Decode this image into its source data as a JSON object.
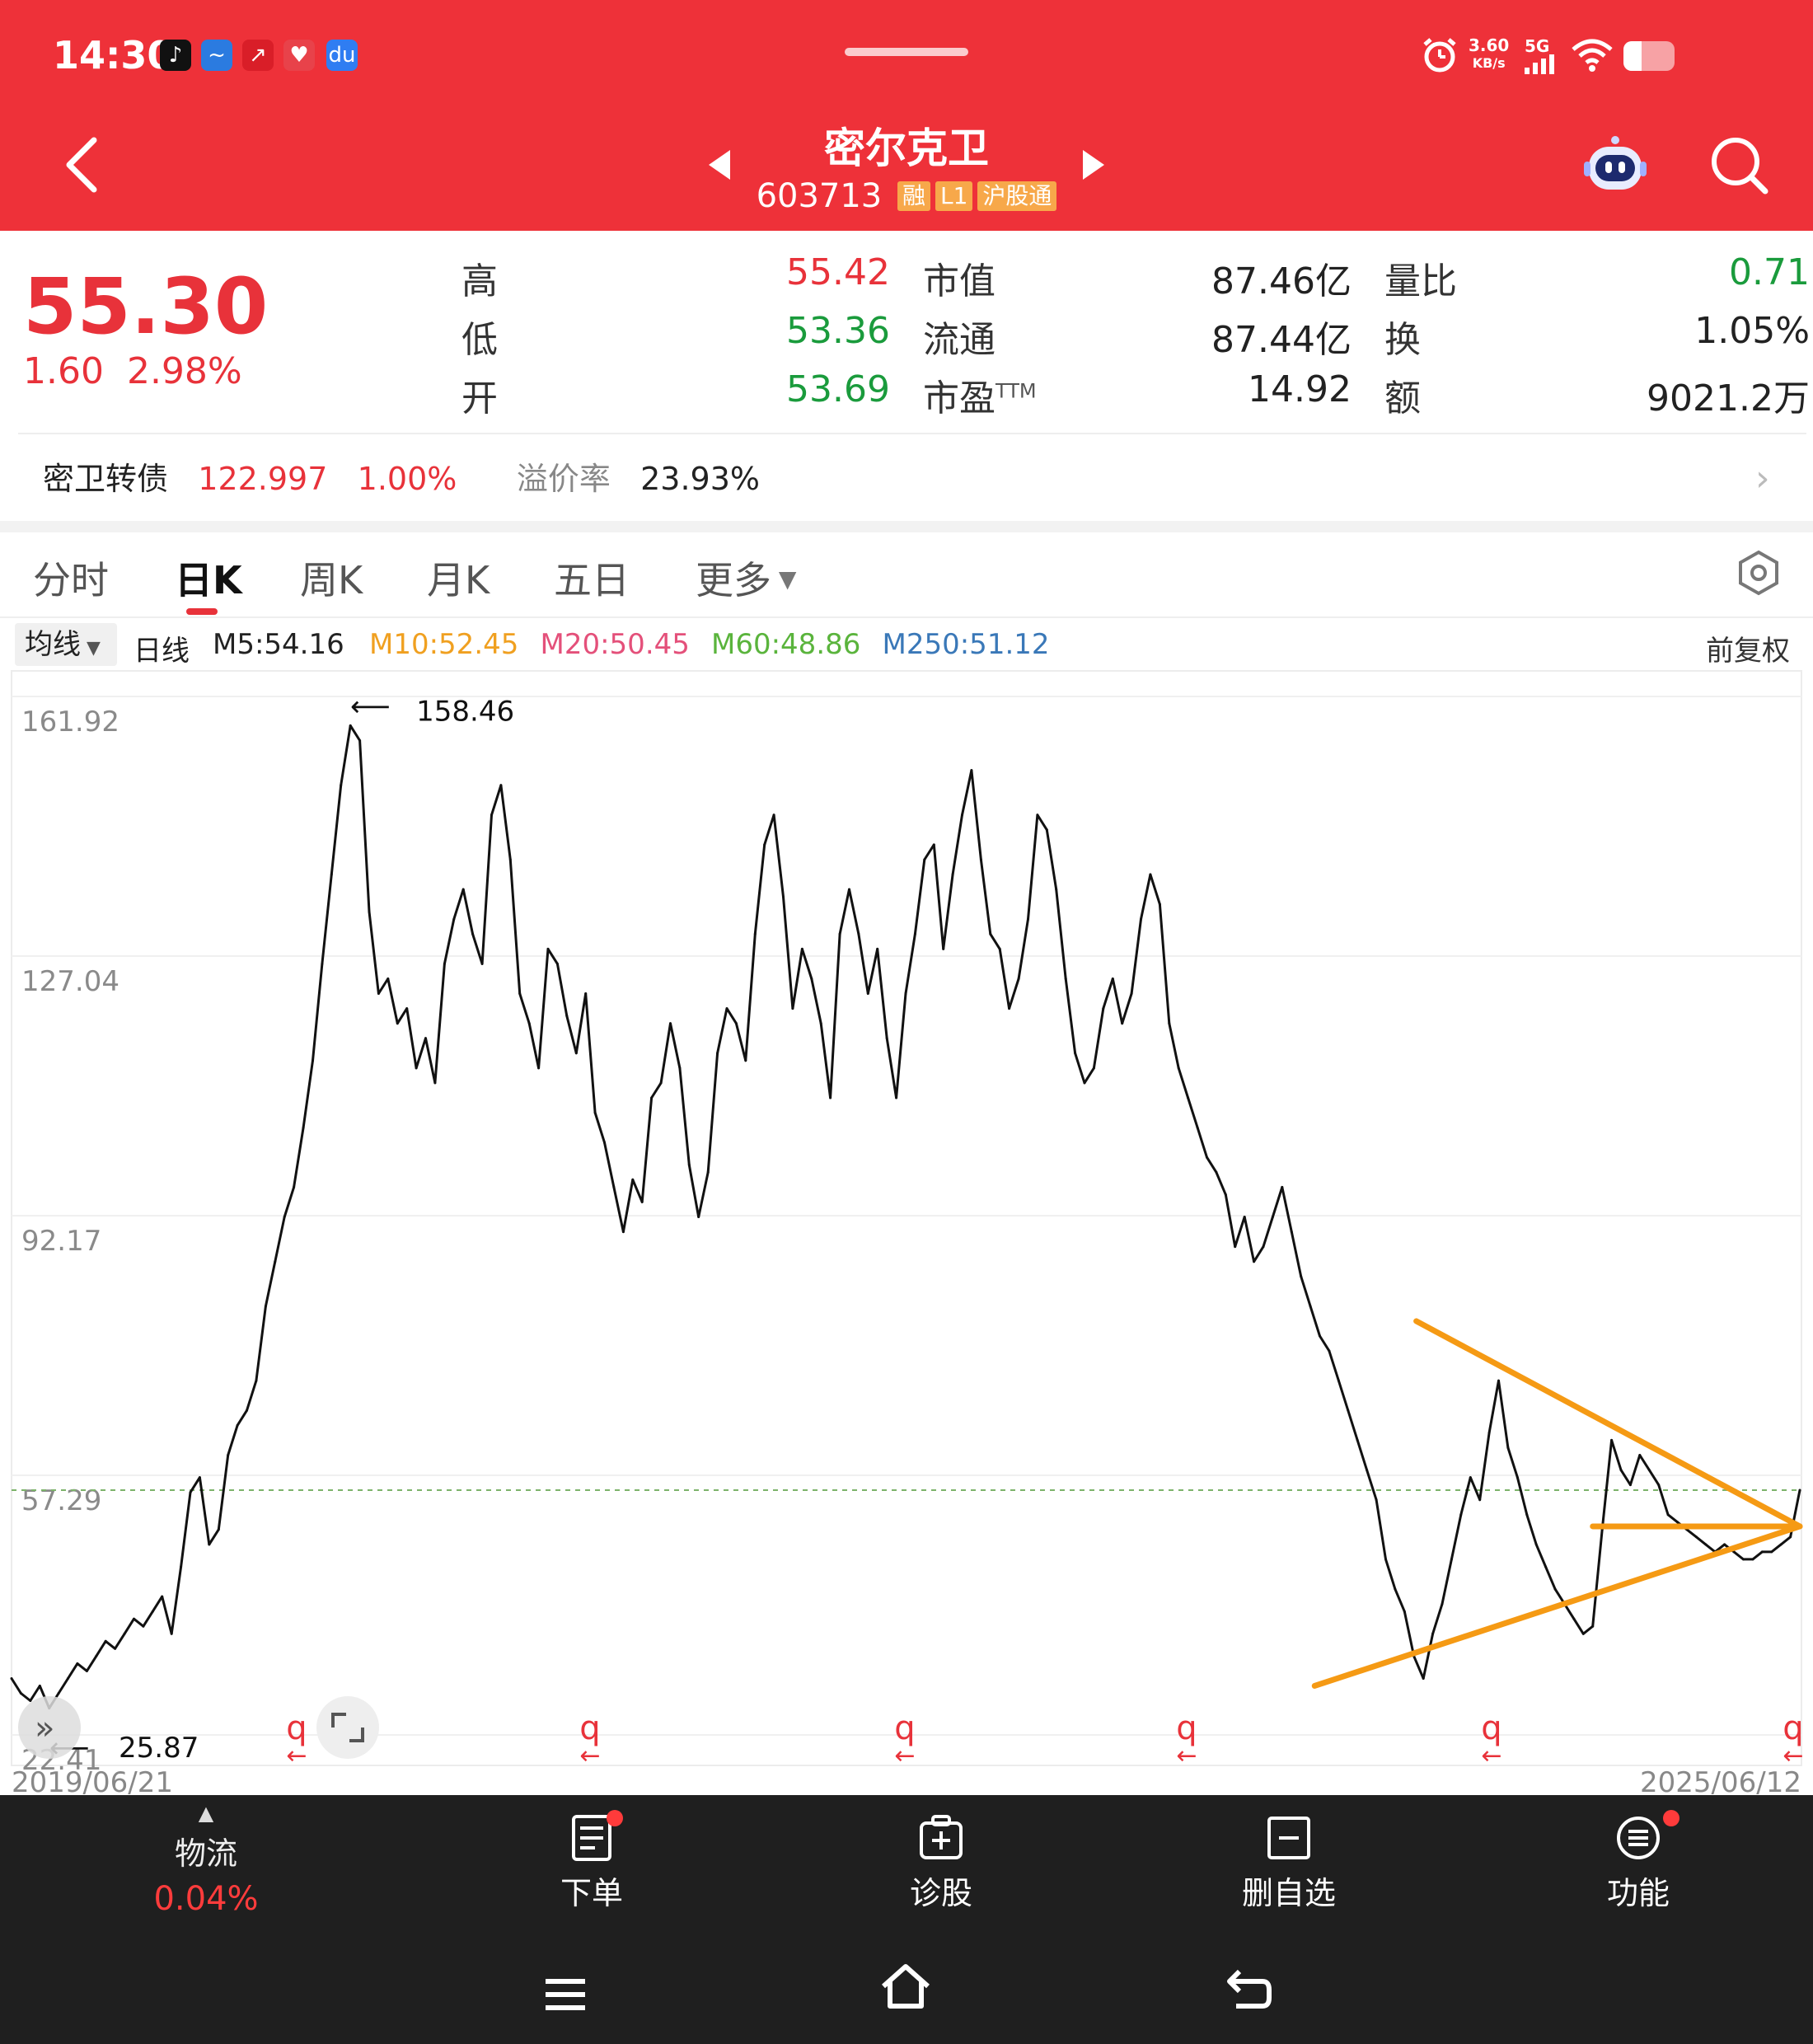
{
  "status": {
    "time": "14:30",
    "net_speed": "3.60",
    "net_unit": "KB/s",
    "signal": "5G",
    "battery_level": 0.35,
    "app_icons": [
      "tiktok-icon",
      "chart-app-icon",
      "finance-app-icon",
      "shop-app-icon",
      "baidu-icon"
    ]
  },
  "header": {
    "title": "密尔克卫",
    "code": "603713",
    "tags": [
      "融",
      "L1",
      "沪股通"
    ]
  },
  "quote": {
    "price": "55.30",
    "change": "1.60",
    "change_pct": "2.98%",
    "rows": [
      [
        {
          "label": "高",
          "value": "55.42",
          "tone": "up"
        },
        {
          "label": "市值",
          "value": "87.46亿",
          "tone": "blk"
        },
        {
          "label": "量比",
          "value": "0.71",
          "tone": "down"
        }
      ],
      [
        {
          "label": "低",
          "value": "53.36",
          "tone": "down"
        },
        {
          "label": "流通",
          "value": "87.44亿",
          "tone": "blk"
        },
        {
          "label": "换",
          "value": "1.05%",
          "tone": "blk"
        }
      ],
      [
        {
          "label": "开",
          "value": "53.69",
          "tone": "down"
        },
        {
          "label": "市盈",
          "sup": "TTM",
          "value": "14.92",
          "tone": "blk"
        },
        {
          "label": "额",
          "value": "9021.2万",
          "tone": "blk"
        }
      ]
    ]
  },
  "bond": {
    "name": "密卫转债",
    "price": "122.997",
    "pct": "1.00%",
    "premium_label": "溢价率",
    "premium": "23.93%"
  },
  "tabs": [
    "分时",
    "日K",
    "周K",
    "月K",
    "五日",
    "更多"
  ],
  "active_tab": 1,
  "ma": {
    "select": "均线",
    "period": "日线",
    "items": [
      {
        "text": "M5:54.16",
        "color": "#222222"
      },
      {
        "text": "M10:52.45",
        "color": "#f0a020"
      },
      {
        "text": "M20:50.45",
        "color": "#e4507a"
      },
      {
        "text": "M60:48.86",
        "color": "#5ab43c"
      },
      {
        "text": "M250:51.12",
        "color": "#3a78b8"
      }
    ],
    "adjust": "前复权"
  },
  "chart_data": {
    "type": "line",
    "ticks_y": [
      "161.92",
      "127.04",
      "92.17",
      "57.29",
      "22.41"
    ],
    "ylim": [
      22.41,
      161.92
    ],
    "x_start_label": "2019/06/21",
    "x_end_label": "2025/06/12",
    "max_label": "158.46",
    "min_label": "25.87",
    "current": 55.3,
    "series": [
      {
        "values": [
          30,
          28,
          27,
          29,
          26,
          28,
          30,
          32,
          31,
          33,
          35,
          34,
          36,
          38,
          37,
          39,
          41,
          36,
          45,
          55,
          57,
          48,
          50,
          60,
          64,
          66,
          70,
          80,
          86,
          92,
          96,
          104,
          113,
          126,
          138,
          150,
          158,
          156,
          133,
          122,
          124,
          118,
          120,
          112,
          116,
          110,
          126,
          132,
          136,
          130,
          126,
          146,
          150,
          140,
          122,
          118,
          112,
          128,
          126,
          119,
          114,
          122,
          106,
          102,
          96,
          90,
          97,
          94,
          108,
          110,
          118,
          112,
          99,
          92,
          98,
          114,
          120,
          118,
          113,
          130,
          142,
          146,
          135,
          120,
          128,
          124,
          118,
          108,
          130,
          136,
          130,
          122,
          128,
          116,
          108,
          122,
          130,
          140,
          142,
          128,
          138,
          146,
          152,
          140,
          130,
          128,
          120,
          124,
          132,
          146,
          144,
          136,
          124,
          114,
          110,
          112,
          120,
          124,
          118,
          122,
          132,
          138,
          134,
          118,
          112,
          108,
          104,
          100,
          98,
          95,
          88,
          92,
          86,
          88,
          92,
          96,
          90,
          84,
          80,
          76,
          74,
          70,
          66,
          62,
          58,
          54,
          46,
          42,
          39,
          33,
          30,
          36,
          40,
          46,
          52,
          57,
          54,
          63,
          70,
          61,
          57,
          52,
          48,
          45,
          42,
          40,
          38,
          36,
          37,
          50,
          62,
          58,
          56,
          60,
          58,
          56,
          52,
          51,
          50,
          49,
          48,
          47,
          48,
          47,
          46,
          46,
          47,
          47,
          48,
          49,
          55.3
        ],
        "color": "#111111"
      }
    ],
    "annotations": {
      "triangle_color": "#f59a14",
      "dashed_line_color": "#7cb36a"
    }
  },
  "footer": {
    "logistics_label": "物流",
    "logistics_pct": "0.04%",
    "buttons": [
      "下单",
      "诊股",
      "删自选",
      "功能"
    ]
  }
}
